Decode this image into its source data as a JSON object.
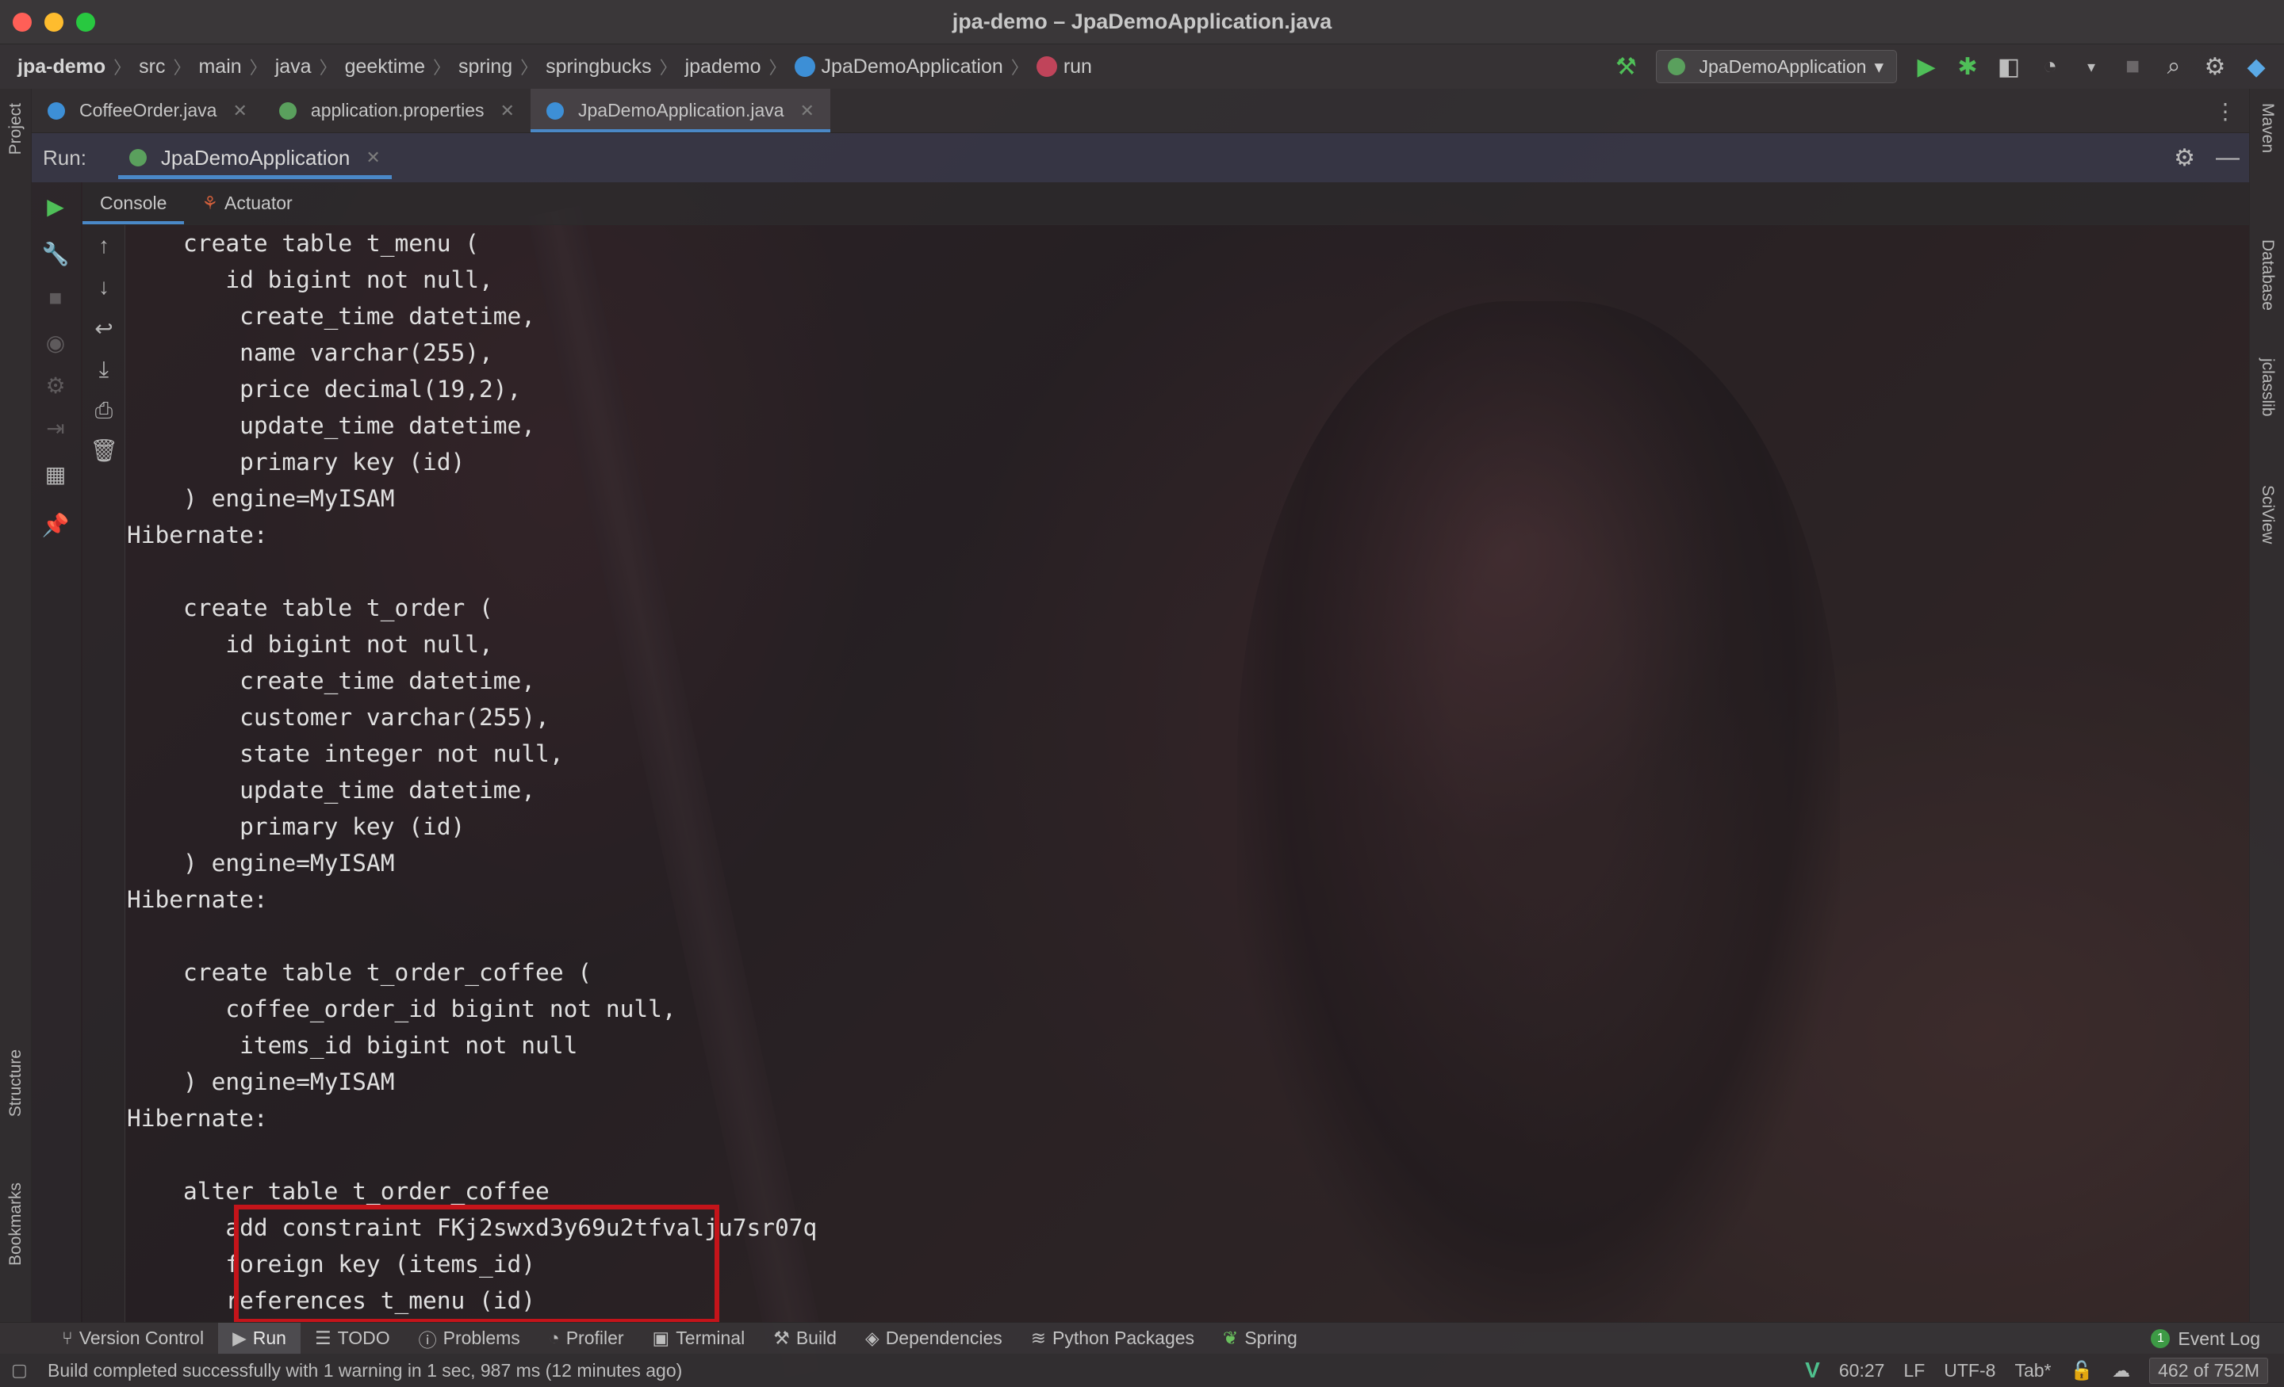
{
  "window": {
    "title": "jpa-demo – JpaDemoApplication.java"
  },
  "breadcrumb": {
    "project": "jpa-demo",
    "items": [
      "src",
      "main",
      "java",
      "geektime",
      "spring",
      "springbucks",
      "jpademo",
      "JpaDemoApplication",
      "run"
    ]
  },
  "toolbar": {
    "run_config": "JpaDemoApplication"
  },
  "editor_tabs": [
    {
      "label": "CoffeeOrder.java"
    },
    {
      "label": "application.properties"
    },
    {
      "label": "JpaDemoApplication.java"
    }
  ],
  "run_panel": {
    "label": "Run:",
    "tab": "JpaDemoApplication",
    "subtabs": [
      "Console",
      "Actuator"
    ]
  },
  "left_strip": {
    "project": "Project",
    "structure": "Structure",
    "bookmarks": "Bookmarks"
  },
  "right_strip": {
    "maven": "Maven",
    "database": "Database",
    "jclasslib": "jclasslib",
    "sciview": "SciView"
  },
  "console_lines": [
    "    create table t_menu (",
    "       id bigint not null,",
    "        create_time datetime,",
    "        name varchar(255),",
    "        price decimal(19,2),",
    "        update_time datetime,",
    "        primary key (id)",
    "    ) engine=MyISAM",
    "Hibernate: ",
    "",
    "    create table t_order (",
    "       id bigint not null,",
    "        create_time datetime,",
    "        customer varchar(255),",
    "        state integer not null,",
    "        update_time datetime,",
    "        primary key (id)",
    "    ) engine=MyISAM",
    "Hibernate: ",
    "",
    "    create table t_order_coffee (",
    "       coffee_order_id bigint not null,",
    "        items_id bigint not null",
    "    ) engine=MyISAM",
    "Hibernate: ",
    "",
    "    alter table t_order_coffee",
    "       add constraint FKj2swxd3y69u2tfvalju7sr07q",
    "       foreign key (items_id)",
    "       references t_menu (id)"
  ],
  "bottom_tools": [
    "Version Control",
    "Run",
    "TODO",
    "Problems",
    "Profiler",
    "Terminal",
    "Build",
    "Dependencies",
    "Python Packages",
    "Spring"
  ],
  "event_log": {
    "label": "Event Log",
    "count": "1"
  },
  "status": {
    "message": "Build completed successfully with 1 warning in 1 sec, 987 ms (12 minutes ago)",
    "position": "60:27",
    "line_sep": "LF",
    "encoding": "UTF-8",
    "indent": "Tab*",
    "memory": "462 of 752M"
  },
  "colors": {
    "accent": "#4a88c7",
    "highlight_box": "#c4141a",
    "run_green": "#4fbf58"
  }
}
